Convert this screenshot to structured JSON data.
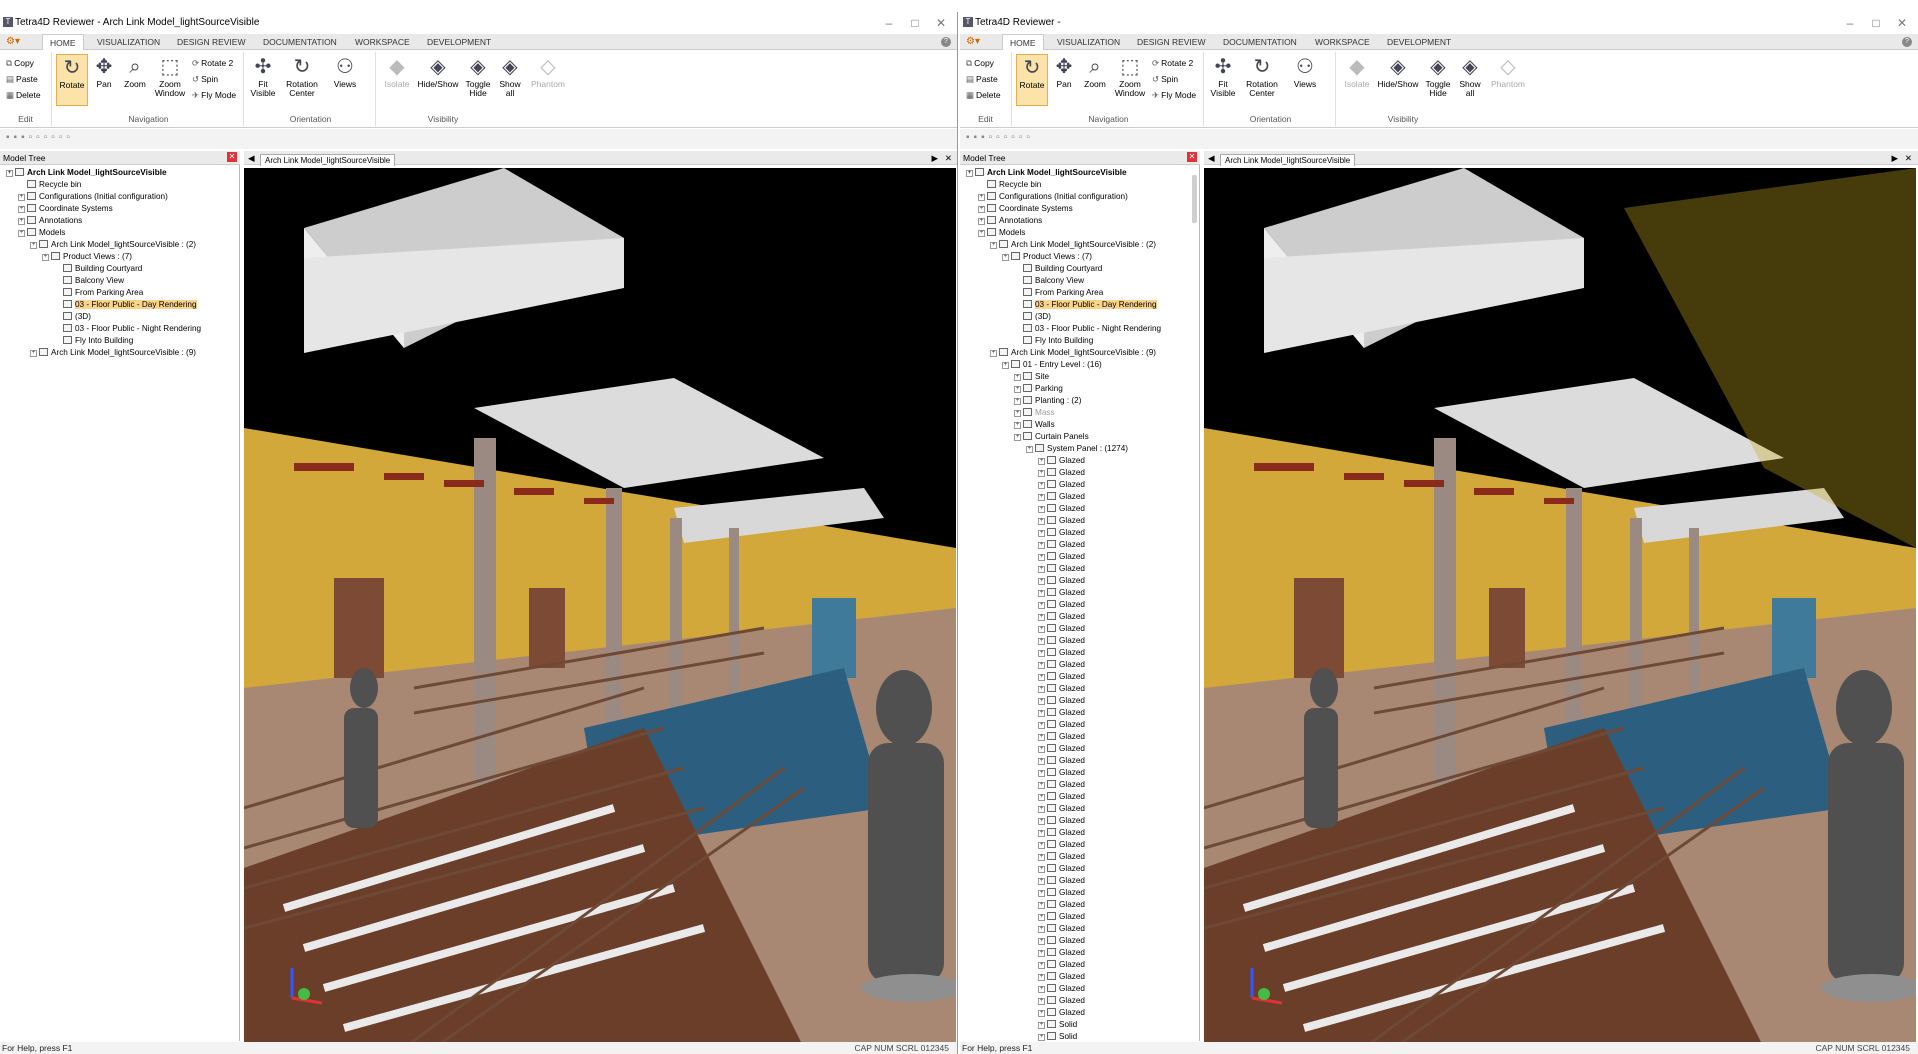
{
  "window_title": "Tetra4D Reviewer - Arch Link Model_lightSourceVisible",
  "window_title_right": "Tetra4D Reviewer -",
  "ribbon_tabs": [
    "HOME",
    "VISUALIZATION",
    "DESIGN REVIEW",
    "DOCUMENTATION",
    "WORKSPACE",
    "DEVELOPMENT"
  ],
  "edit": {
    "copy": "Copy",
    "paste": "Paste",
    "delete": "Delete",
    "group": "Edit"
  },
  "navigation": {
    "rotate": "Rotate",
    "pan": "Pan",
    "zoom": "Zoom",
    "zoom_window": "Zoom Window",
    "rotate2": "Rotate 2",
    "spin": "Spin",
    "fly_mode": "Fly Mode",
    "group": "Navigation"
  },
  "orientation": {
    "fit_visible": "Fit Visible",
    "rotation_center": "Rotation Center",
    "views": "Views",
    "group": "Orientation"
  },
  "visibility": {
    "isolate": "Isolate",
    "hide_show": "Hide/Show",
    "toggle_hide": "Toggle Hide",
    "show_all": "Show all",
    "phantom": "Phantom",
    "group": "Visibility"
  },
  "model_tree_title": "Model Tree",
  "viewport_tab": "Arch Link Model_lightSourceVisible",
  "status_help": "For Help, press F1",
  "status_indicators": "CAP NUM SCRL 012345",
  "tree_left": [
    {
      "label": "Arch Link Model_lightSourceVisible",
      "bold": true
    },
    {
      "label": "Recycle bin"
    },
    {
      "label": "Configurations (Initial configuration)"
    },
    {
      "label": "Coordinate Systems"
    },
    {
      "label": "Annotations"
    },
    {
      "label": "Models"
    },
    {
      "label": "Arch Link Model_lightSourceVisible : (2)"
    },
    {
      "label": "Product Views : (7)"
    },
    {
      "label": "Building Courtyard"
    },
    {
      "label": "Balcony View"
    },
    {
      "label": "From Parking Area"
    },
    {
      "label": "03 - Floor Public - Day Rendering",
      "selected": true
    },
    {
      "label": "(3D)"
    },
    {
      "label": "03 - Floor Public - Night Rendering"
    },
    {
      "label": "Fly Into Building"
    },
    {
      "label": "Arch Link Model_lightSourceVisible : (9)"
    }
  ],
  "tree_right_extra": [
    {
      "label": "01 - Entry Level : (16)"
    },
    {
      "label": "Site"
    },
    {
      "label": "Parking"
    },
    {
      "label": "Planting : (2)"
    },
    {
      "label": "Mass",
      "dim": true
    },
    {
      "label": "Walls"
    },
    {
      "label": "Curtain Panels"
    },
    {
      "label": "System Panel : (1274)"
    }
  ],
  "glazed_label": "Glazed",
  "solid_label": "Solid"
}
